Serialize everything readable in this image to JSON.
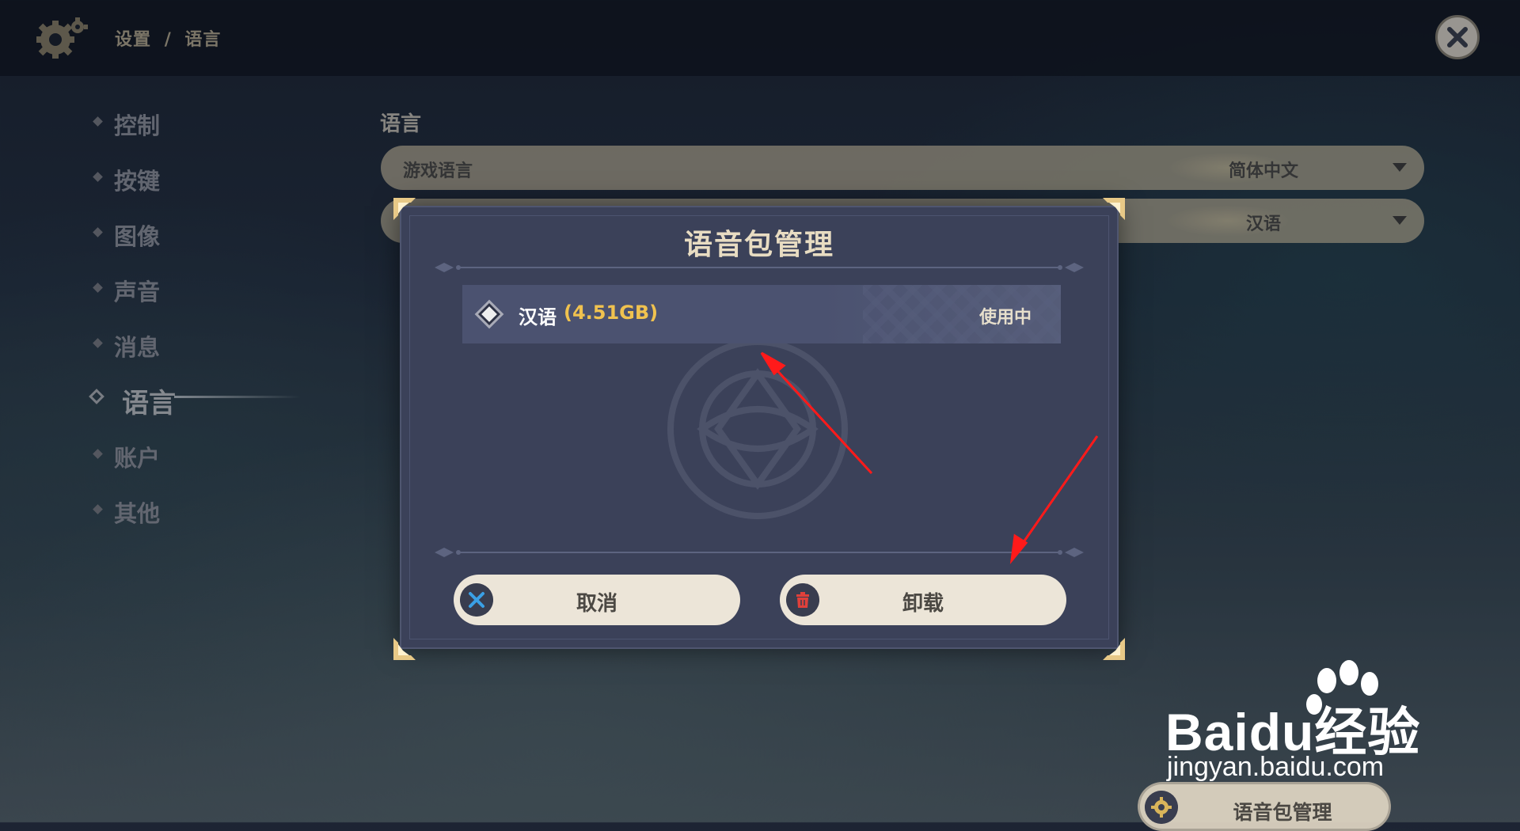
{
  "breadcrumb": {
    "parent": "设置",
    "separator": "/",
    "current": "语言"
  },
  "sidebar": {
    "items": [
      {
        "label": "控制"
      },
      {
        "label": "按键"
      },
      {
        "label": "图像"
      },
      {
        "label": "声音"
      },
      {
        "label": "消息"
      },
      {
        "label": "语言",
        "active": true
      },
      {
        "label": "账户"
      },
      {
        "label": "其他"
      }
    ]
  },
  "main": {
    "section_title": "语言",
    "rows": [
      {
        "label": "游戏语言",
        "value": "简体中文"
      },
      {
        "label": "",
        "value": "汉语"
      }
    ]
  },
  "dialog": {
    "title": "语音包管理",
    "pack": {
      "name": "汉语",
      "size": "(4.51GB)",
      "status": "使用中"
    },
    "cancel_label": "取消",
    "uninstall_label": "卸载"
  },
  "bottom_button": {
    "label": "语音包管理"
  },
  "watermark": {
    "brand": "Baidu经验",
    "url": "jingyan.baidu.com"
  },
  "icons": {
    "settings": "gear-icon",
    "close": "close-icon",
    "dropdown": "chevron-down-icon",
    "cancel": "x-icon",
    "uninstall": "trash-icon"
  },
  "colors": {
    "dialog_bg": "#3b4159",
    "accent_gold": "#f0c24f",
    "button_bg": "#ece5d8",
    "trash_red": "#e0403a",
    "cancel_blue": "#3aa0e6",
    "annotation_red": "#ff1a1a"
  }
}
